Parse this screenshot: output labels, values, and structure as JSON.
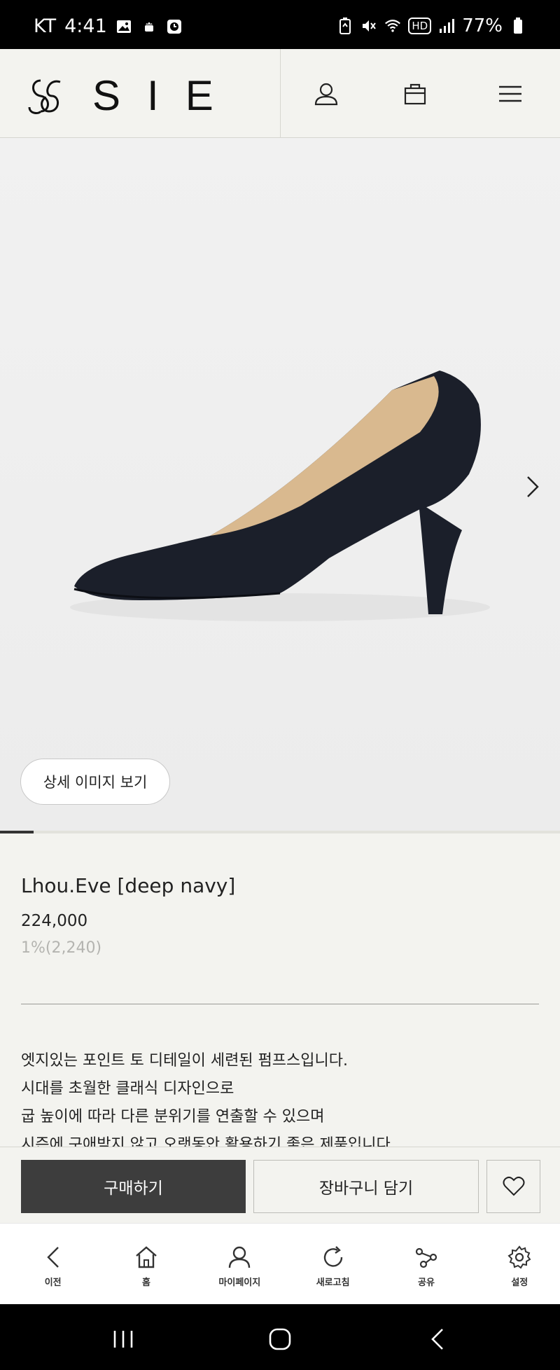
{
  "status_bar": {
    "carrier": "KT",
    "time": "4:41",
    "battery": "77%",
    "hd_badge": "HD",
    "icons_left": [
      "image-icon",
      "android-icon",
      "clock-icon"
    ],
    "icons_right": [
      "battery-saver-icon",
      "mute-icon",
      "wifi-icon",
      "signal-icon",
      "battery-icon"
    ]
  },
  "header": {
    "logo_text": "SIE",
    "icons": [
      "user-icon",
      "bag-icon",
      "menu-icon"
    ]
  },
  "gallery": {
    "detail_button": "상세 이미지 보기",
    "progress_fraction": 0.06
  },
  "product": {
    "name": "Lhou.Eve [deep navy]",
    "price": "224,000",
    "points": "1%(2,240)",
    "description": [
      "엣지있는 포인트 토 디테일이 세련된 펌프스입니다.",
      "시대를 초월한 클래식 디자인으로",
      "굽 높이에 따라 다른 분위기를 연출할 수 있으며",
      "시즌에 구애받지 않고 오랫동안 활용하기 좋은 제품입니다."
    ]
  },
  "actions": {
    "buy": "구매하기",
    "cart": "장바구니 담기"
  },
  "browser_nav": {
    "items": [
      {
        "label": "이전",
        "icon": "back-icon"
      },
      {
        "label": "홈",
        "icon": "home-icon"
      },
      {
        "label": "마이페이지",
        "icon": "mypage-icon"
      },
      {
        "label": "새로고침",
        "icon": "refresh-icon"
      },
      {
        "label": "공유",
        "icon": "share-icon"
      },
      {
        "label": "설정",
        "icon": "settings-icon"
      }
    ]
  },
  "colors": {
    "background": "#f3f3ef",
    "primary_button": "#3d3d3d",
    "shoe": "#1b1f2a",
    "lining": "#d9b98f"
  }
}
